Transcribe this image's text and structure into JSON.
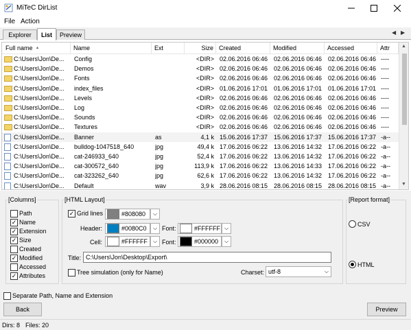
{
  "window": {
    "title": "MiTeC DirList"
  },
  "menu": [
    "File",
    "Action"
  ],
  "tabs": [
    "Explorer",
    "List",
    "Preview"
  ],
  "list": {
    "columns": [
      "Full name",
      "Name",
      "Ext",
      "Size",
      "Created",
      "Modified",
      "Accessed",
      "Attr"
    ],
    "rows": [
      {
        "full": "C:\\Users\\Jon\\De...",
        "name": "Config",
        "ext": "",
        "size": "<DIR>",
        "created": "02.06.2016 06:46",
        "modified": "02.06.2016 06:46",
        "accessed": "02.06.2016 06:46",
        "attr": "----",
        "kind": "folder"
      },
      {
        "full": "C:\\Users\\Jon\\De...",
        "name": "Demos",
        "ext": "",
        "size": "<DIR>",
        "created": "02.06.2016 06:46",
        "modified": "02.06.2016 06:46",
        "accessed": "02.06.2016 06:46",
        "attr": "----",
        "kind": "folder"
      },
      {
        "full": "C:\\Users\\Jon\\De...",
        "name": "Fonts",
        "ext": "",
        "size": "<DIR>",
        "created": "02.06.2016 06:46",
        "modified": "02.06.2016 06:46",
        "accessed": "02.06.2016 06:46",
        "attr": "----",
        "kind": "folder"
      },
      {
        "full": "C:\\Users\\Jon\\De...",
        "name": "index_files",
        "ext": "",
        "size": "<DIR>",
        "created": "01.06.2016 17:01",
        "modified": "01.06.2016 17:01",
        "accessed": "01.06.2016 17:01",
        "attr": "----",
        "kind": "folder"
      },
      {
        "full": "C:\\Users\\Jon\\De...",
        "name": "Levels",
        "ext": "",
        "size": "<DIR>",
        "created": "02.06.2016 06:46",
        "modified": "02.06.2016 06:46",
        "accessed": "02.06.2016 06:46",
        "attr": "----",
        "kind": "folder"
      },
      {
        "full": "C:\\Users\\Jon\\De...",
        "name": "Log",
        "ext": "",
        "size": "<DIR>",
        "created": "02.06.2016 06:46",
        "modified": "02.06.2016 06:46",
        "accessed": "02.06.2016 06:46",
        "attr": "----",
        "kind": "folder"
      },
      {
        "full": "C:\\Users\\Jon\\De...",
        "name": "Sounds",
        "ext": "",
        "size": "<DIR>",
        "created": "02.06.2016 06:46",
        "modified": "02.06.2016 06:46",
        "accessed": "02.06.2016 06:46",
        "attr": "----",
        "kind": "folder"
      },
      {
        "full": "C:\\Users\\Jon\\De...",
        "name": "Textures",
        "ext": "",
        "size": "<DIR>",
        "created": "02.06.2016 06:46",
        "modified": "02.06.2016 06:46",
        "accessed": "02.06.2016 06:46",
        "attr": "----",
        "kind": "folder"
      },
      {
        "full": "C:\\Users\\Jon\\De...",
        "name": "Banner",
        "ext": "as",
        "size": "4,1 k",
        "created": "15.06.2016 17:37",
        "modified": "15.06.2016 17:37",
        "accessed": "15.06.2016 17:37",
        "attr": "-a--",
        "kind": "file"
      },
      {
        "full": "C:\\Users\\Jon\\De...",
        "name": "bulldog-1047518_640",
        "ext": "jpg",
        "size": "49,4 k",
        "created": "17.06.2016 06:22",
        "modified": "13.06.2016 14:32",
        "accessed": "17.06.2016 06:22",
        "attr": "-a--",
        "kind": "file"
      },
      {
        "full": "C:\\Users\\Jon\\De...",
        "name": "cat-246933_640",
        "ext": "jpg",
        "size": "52,4 k",
        "created": "17.06.2016 06:22",
        "modified": "13.06.2016 14:32",
        "accessed": "17.06.2016 06:22",
        "attr": "-a--",
        "kind": "file"
      },
      {
        "full": "C:\\Users\\Jon\\De...",
        "name": "cat-300572_640",
        "ext": "jpg",
        "size": "113,9 k",
        "created": "17.06.2016 06:22",
        "modified": "13.06.2016 14:33",
        "accessed": "17.06.2016 06:22",
        "attr": "-a--",
        "kind": "file"
      },
      {
        "full": "C:\\Users\\Jon\\De...",
        "name": "cat-323262_640",
        "ext": "jpg",
        "size": "62,6 k",
        "created": "17.06.2016 06:22",
        "modified": "13.06.2016 14:32",
        "accessed": "17.06.2016 06:22",
        "attr": "-a--",
        "kind": "file"
      },
      {
        "full": "C:\\Users\\Jon\\De...",
        "name": "Default",
        "ext": "wav",
        "size": "3,9 k",
        "created": "28.06.2016 08:15",
        "modified": "28.06.2016 08:15",
        "accessed": "28.06.2016 08:15",
        "attr": "-a--",
        "kind": "file"
      }
    ]
  },
  "columns_group": {
    "title": "[Columns]",
    "items": [
      {
        "label": "Path",
        "checked": false
      },
      {
        "label": "Name",
        "checked": true
      },
      {
        "label": "Extension",
        "checked": true
      },
      {
        "label": "Size",
        "checked": true
      },
      {
        "label": "Created",
        "checked": false
      },
      {
        "label": "Modified",
        "checked": true
      },
      {
        "label": "Accessed",
        "checked": false
      },
      {
        "label": "Attributes",
        "checked": true
      }
    ]
  },
  "html_layout": {
    "title": "[HTML Layout]",
    "grid_lines_label": "Grid lines",
    "grid_color": "#808080",
    "header_label": "Header:",
    "header_bg": "#0080C0",
    "header_font_label": "Font:",
    "header_font": "#FFFFFF",
    "cell_label": "Cell:",
    "cell_bg": "#FFFFFF",
    "cell_font_label": "Font:",
    "cell_font": "#000000",
    "title_label": "Title:",
    "title_value": "C:\\Users\\Jon\\Desktop\\Export\\",
    "tree_label": "Tree simulation (only for Name)",
    "charset_label": "Charset:",
    "charset_value": "utf-8"
  },
  "report_format": {
    "title": "[Report format]",
    "csv_label": "CSV",
    "html_label": "HTML",
    "selected": "HTML"
  },
  "separate_label": "Separate Path, Name and Extension",
  "buttons": {
    "back": "Back",
    "preview": "Preview"
  },
  "status": {
    "dirs": "Dirs: 8",
    "files": "Files: 20"
  }
}
